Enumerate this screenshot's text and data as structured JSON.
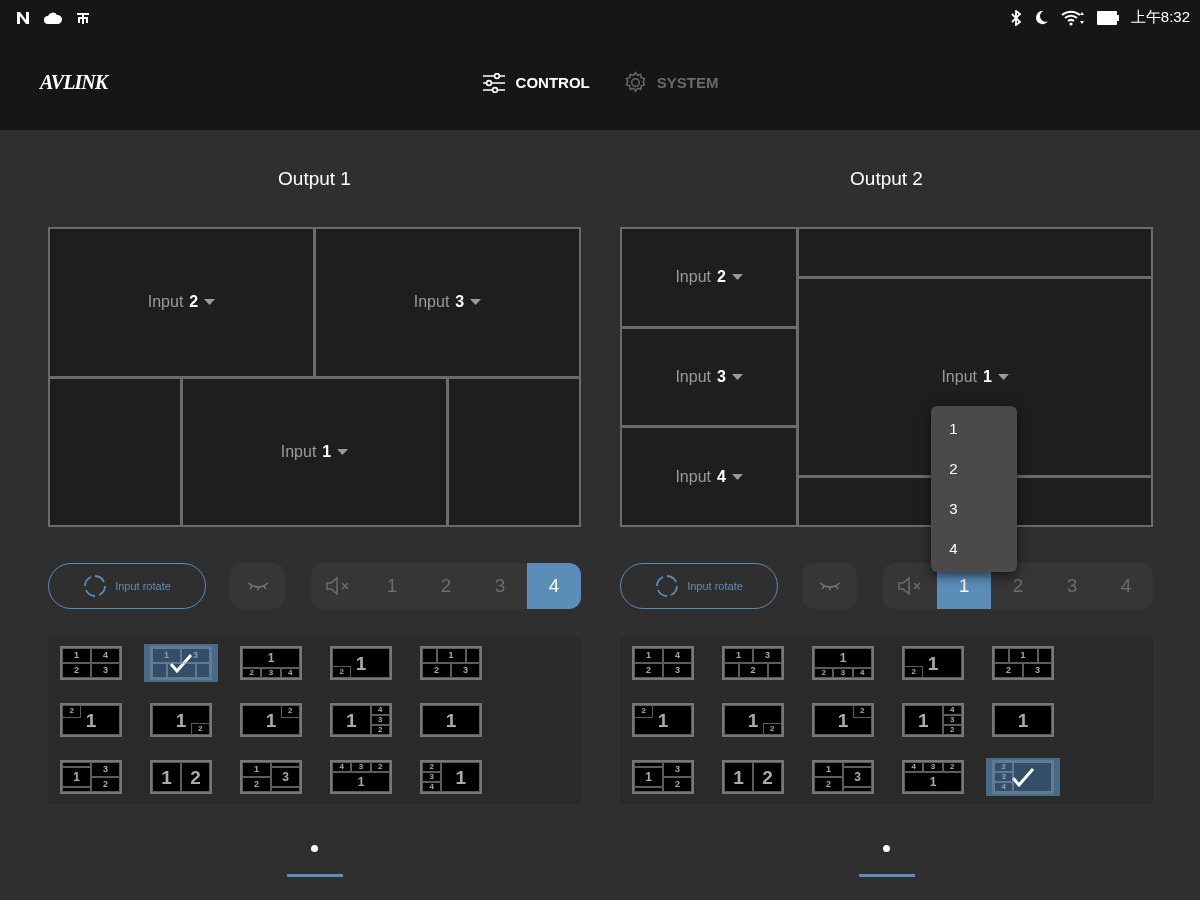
{
  "status_bar": {
    "time": "上午8:32"
  },
  "header": {
    "logo": "AVLINK",
    "tabs": [
      {
        "label": "CONTROL",
        "selected": true
      },
      {
        "label": "SYSTEM",
        "selected": false
      }
    ]
  },
  "outputs": [
    {
      "title": "Output 1",
      "preview": {
        "kind": "top2-bottom3",
        "cells": [
          {
            "label": "Input **2**"
          },
          {
            "label": "Input **3**"
          },
          {
            "label": "Input **1**"
          }
        ]
      },
      "rotate_button": "Input rotate",
      "audio_channels": [
        {
          "label": "1",
          "selected": false
        },
        {
          "label": "2",
          "selected": false
        },
        {
          "label": "3",
          "selected": false
        },
        {
          "label": "4",
          "selected": true
        }
      ],
      "layouts": [
        {
          "kind": "quad",
          "labels": [
            "1",
            "4",
            "2",
            "3"
          ],
          "selected": false
        },
        {
          "kind": "top2-bottom3",
          "labels": [
            "1",
            "3"
          ],
          "selected": true
        },
        {
          "kind": "top-big-bottom3",
          "labels": [
            "1",
            "2",
            "3",
            "4"
          ],
          "selected": false
        },
        {
          "kind": "pip-bl",
          "labels": [
            "2",
            "1"
          ],
          "selected": false
        },
        {
          "kind": "top3-bottom2",
          "labels": [
            "1",
            "2",
            "3"
          ],
          "selected": false
        },
        {
          "kind": "pip-tl",
          "labels": [
            "2",
            "1"
          ],
          "selected": false
        },
        {
          "kind": "pip-br",
          "labels": [
            "1",
            "2"
          ],
          "selected": false
        },
        {
          "kind": "pip-tr",
          "labels": [
            "1",
            "2"
          ],
          "selected": false
        },
        {
          "kind": "big-right3",
          "labels": [
            "1",
            "4",
            "3",
            "2"
          ],
          "selected": false
        },
        {
          "kind": "single",
          "labels": [
            "1"
          ],
          "selected": false
        },
        {
          "kind": "left-mid-right2",
          "labels": [
            "1",
            "3",
            "2"
          ],
          "selected": false
        },
        {
          "kind": "split",
          "labels": [
            "1",
            "2"
          ],
          "selected": false
        },
        {
          "kind": "left2-right-mid",
          "labels": [
            "1",
            "2",
            "3"
          ],
          "selected": false
        },
        {
          "kind": "top3-bottom-big",
          "labels": [
            "4",
            "3",
            "2",
            "1"
          ],
          "selected": false
        },
        {
          "kind": "left3-big",
          "labels": [
            "2",
            "3",
            "4",
            "1"
          ],
          "selected": false
        }
      ]
    },
    {
      "title": "Output 2",
      "preview": {
        "kind": "left3-big-strips",
        "cells": [
          {
            "label": "Input **2**"
          },
          {
            "label": "Input **3**"
          },
          {
            "label": "Input **4**"
          },
          {
            "label": "Input **1**",
            "menu": [
              "1",
              "2",
              "3",
              "4"
            ]
          }
        ]
      },
      "rotate_button": "Input rotate",
      "audio_channels": [
        {
          "label": "1",
          "selected": true
        },
        {
          "label": "2",
          "selected": false
        },
        {
          "label": "3",
          "selected": false
        },
        {
          "label": "4",
          "selected": false
        }
      ],
      "layouts": [
        {
          "kind": "quad",
          "labels": [
            "1",
            "4",
            "2",
            "3"
          ],
          "selected": false
        },
        {
          "kind": "top2-bottom3",
          "labels": [
            "1",
            "3",
            "2"
          ],
          "selected": false
        },
        {
          "kind": "top-big-bottom3",
          "labels": [
            "1",
            "2",
            "3",
            "4"
          ],
          "selected": false
        },
        {
          "kind": "pip-bl",
          "labels": [
            "2",
            "1"
          ],
          "selected": false
        },
        {
          "kind": "top3-bottom2",
          "labels": [
            "1",
            "2",
            "3"
          ],
          "selected": false
        },
        {
          "kind": "pip-tl",
          "labels": [
            "2",
            "1"
          ],
          "selected": false
        },
        {
          "kind": "pip-br",
          "labels": [
            "1",
            "2"
          ],
          "selected": false
        },
        {
          "kind": "pip-tr",
          "labels": [
            "1",
            "2"
          ],
          "selected": false
        },
        {
          "kind": "big-right3",
          "labels": [
            "1",
            "4",
            "3",
            "2"
          ],
          "selected": false
        },
        {
          "kind": "single",
          "labels": [
            "1"
          ],
          "selected": false
        },
        {
          "kind": "left-mid-right2",
          "labels": [
            "1",
            "3",
            "2"
          ],
          "selected": false
        },
        {
          "kind": "split",
          "labels": [
            "1",
            "2"
          ],
          "selected": false
        },
        {
          "kind": "left2-right-mid",
          "labels": [
            "1",
            "2",
            "3"
          ],
          "selected": false
        },
        {
          "kind": "top3-bottom-big",
          "labels": [
            "4",
            "3",
            "2",
            "1"
          ],
          "selected": false
        },
        {
          "kind": "left3-big",
          "labels": [
            "2",
            "3",
            "4"
          ],
          "selected": true
        }
      ]
    }
  ]
}
